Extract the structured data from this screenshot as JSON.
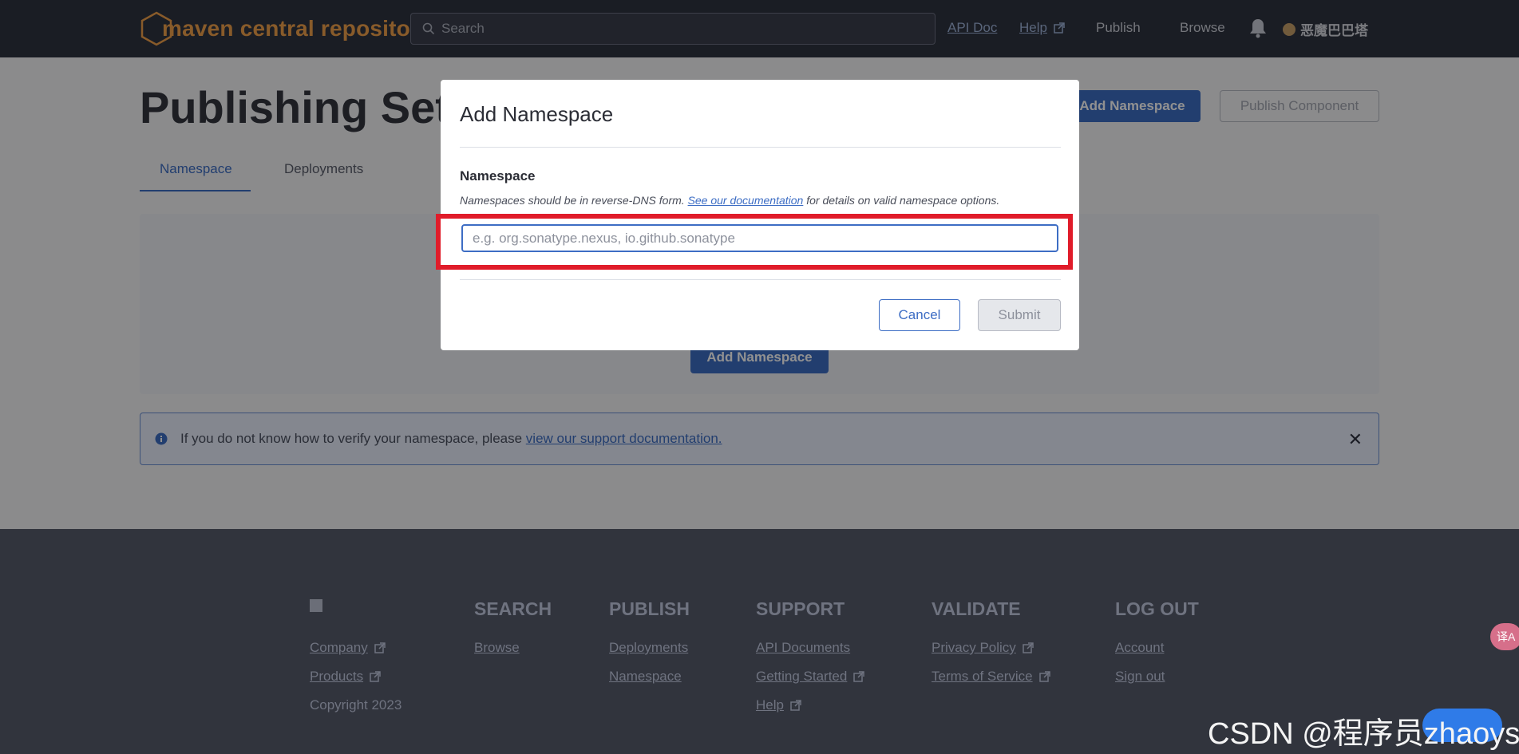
{
  "nav": {
    "logo_text": "maven central repository",
    "search_placeholder": "Search",
    "links": [
      "API Doc",
      "Help",
      "Publish",
      "Browse"
    ],
    "user_name": "恶魔巴巴塔"
  },
  "page": {
    "title": "Publishing Setti",
    "add_namespace_label": "Add Namespace",
    "publish_component_label": "Publish Component",
    "tabs": [
      "Namespace",
      "Deployments"
    ],
    "panel_button_label": "Add Namespace",
    "info": {
      "text": "If you do not know how to verify your namespace, please ",
      "link": "view our support documentation."
    }
  },
  "modal": {
    "title": "Add Namespace",
    "field_label": "Namespace",
    "help_prefix": "Namespaces should be in reverse-DNS form. ",
    "help_link": "See our documentation",
    "help_suffix": " for details on valid namespace options.",
    "input_placeholder": "e.g. org.sonatype.nexus, io.github.sonatype",
    "input_value": "",
    "cancel_label": "Cancel",
    "submit_label": "Submit"
  },
  "footer": {
    "columns": [
      {
        "title": "",
        "links": [
          "Company",
          "Products"
        ],
        "text": "Copyright 2023"
      },
      {
        "title": "SEARCH",
        "links": [
          "Browse"
        ]
      },
      {
        "title": "PUBLISH",
        "links": [
          "Deployments",
          "Namespace"
        ]
      },
      {
        "title": "SUPPORT",
        "links": [
          "API Documents",
          "Getting Started",
          "Help"
        ]
      },
      {
        "title": "VALIDATE",
        "links": [
          "Privacy Policy",
          "Terms of Service"
        ]
      },
      {
        "title": "LOG OUT",
        "links": [
          "Account",
          "Sign out"
        ]
      }
    ]
  },
  "overlays": {
    "translate_label": "译A",
    "watermark": "CSDN @程序员zhaoyss"
  },
  "colors": {
    "accent": "#3d6dc4",
    "highlight": "#e01c2a",
    "brand": "#f0a04b"
  }
}
